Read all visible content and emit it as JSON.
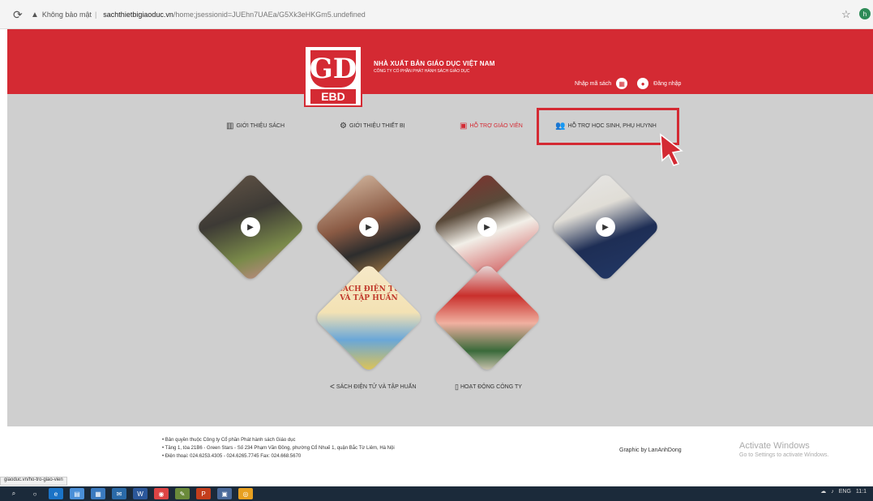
{
  "browser": {
    "security_label": "Không bảo mật",
    "url_host": "sachthietbigiaoduc.vn",
    "url_rest": "/home;jsessionid=JUEhn7UAEa/G5Xk3eHKGm5.undefined",
    "profile_initial": "h"
  },
  "header": {
    "logo_top": "GD",
    "logo_bottom": "EBD",
    "brand_title": "NHÀ XUẤT BẢN GIÁO DỤC VIỆT NAM",
    "brand_sub": "CÔNG TY CỔ PHẦN PHÁT HÀNH SÁCH GIÁO DỤC",
    "code_label": "Nhập mã sách",
    "login_label": "Đăng nhập"
  },
  "nav": {
    "items": [
      {
        "label": "GIỚI THIỆU SÁCH",
        "icon": "books-icon"
      },
      {
        "label": "GIỚI THIỆU THIẾT BỊ",
        "icon": "devices-icon"
      },
      {
        "label": "HỖ TRỢ GIÁO VIÊN",
        "icon": "teacher-icon"
      },
      {
        "label": "HỖ TRỢ HỌC SINH, PHỤ HUYNH",
        "icon": "users-icon"
      }
    ]
  },
  "bottom_links": {
    "share": "SÁCH ĐIỆN TỬ VÀ TẬP HUẤN",
    "company": "HOẠT ĐỘNG CÔNG TY"
  },
  "book_tile": {
    "line1": "SÁCH ĐIỆN TỬ",
    "line2": "VÀ TẬP HUẤN"
  },
  "footer": {
    "line1": "• Bản quyền thuộc Công ty Cổ phần Phát hành sách Giáo dục",
    "line2": "• Tầng 1, tòa 21B6 - Green Stars - Số 234 Phạm Văn Đồng, phường Cổ Nhuế 1, quận Bắc Từ Liêm, Hà Nội",
    "line3": "• Điện thoại: 024.6253.4305 - 024.6265.7745     Fax: 024.668.5670",
    "graphic": "Graphic by LanAnhDong",
    "activate_title": "Activate Windows",
    "activate_sub": "Go to Settings to activate Windows."
  },
  "status_url": "giaoduc.vn/ho-tro-giao-vien",
  "tray": {
    "lang": "ENG",
    "time": "11:1"
  },
  "colors": {
    "brand_red": "#d42a33",
    "page_bg": "#cfcfcf"
  }
}
